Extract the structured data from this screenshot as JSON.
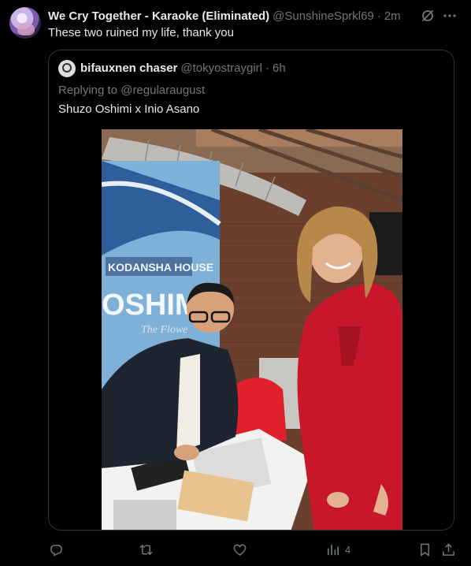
{
  "tweet": {
    "display_name": "We Cry Together - Karaoke (Eliminated)",
    "handle": "@SunshineSprkl69",
    "separator": "·",
    "time": "2m",
    "text": "These two ruined my life, thank you"
  },
  "quote": {
    "display_name": "bifauxnen chaser",
    "handle": "@tokyostraygirl",
    "separator": "·",
    "time": "6h",
    "replying_to": "Replying to @regularaugust",
    "text": "Shuzo Oshimi x Inio Asano",
    "photo": {
      "poster_brand": "KODANSHA HOUSE",
      "poster_title": "OSHIM",
      "poster_subtitle": "The Flowe"
    }
  },
  "actions": {
    "views": "4"
  },
  "colors": {
    "background": "#000000",
    "primary_text": "#e7e9ea",
    "secondary_text": "#71767b",
    "border": "#2f3336"
  },
  "icons": [
    "reply-icon",
    "retweet-icon",
    "like-icon",
    "views-icon",
    "bookmark-icon",
    "share-icon",
    "grok-icon",
    "more-icon"
  ]
}
